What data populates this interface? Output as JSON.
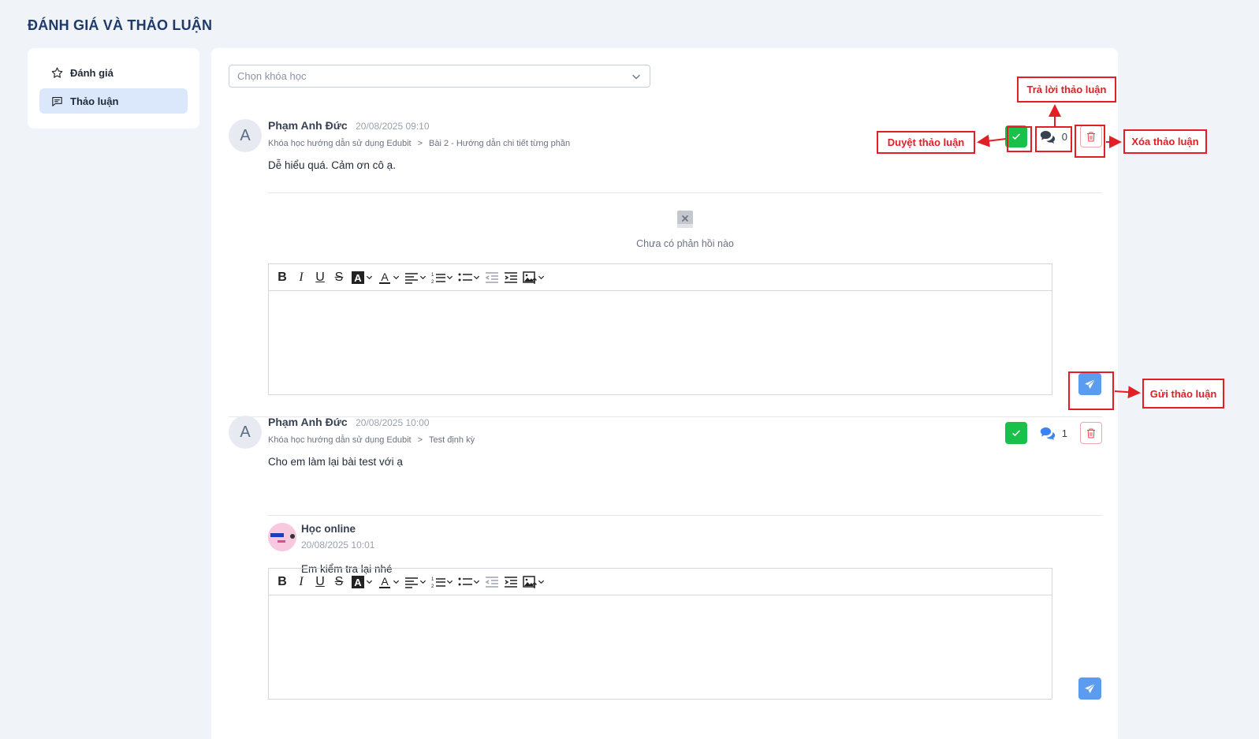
{
  "page": {
    "title": "ĐÁNH GIÁ VÀ THẢO LUẬN"
  },
  "sidebar": {
    "items": [
      {
        "label": "Đánh giá",
        "icon": "star-icon",
        "active": false
      },
      {
        "label": "Thảo luận",
        "icon": "chat-icon",
        "active": true
      }
    ]
  },
  "course_select": {
    "placeholder": "Chọn khóa học"
  },
  "discussions": [
    {
      "avatar_letter": "A",
      "author": "Phạm Anh Đức",
      "time": "20/08/2025 09:10",
      "course": "Khóa học hướng dẫn sử dụng Edubit",
      "separator": ">",
      "lesson": "Bài 2 - Hướng dẫn chi tiết từng phần",
      "content": "Dễ hiểu quá. Cảm ơn cô ạ.",
      "reply_count": "0",
      "empty_text": "Chưa có phản hồi nào"
    },
    {
      "avatar_letter": "A",
      "author": "Phạm Anh Đức",
      "time": "20/08/2025 10:00",
      "course": "Khóa học hướng dẫn sử dụng Edubit",
      "separator": ">",
      "lesson": "Test định kỳ",
      "content": "Cho em làm lại bài test với ạ",
      "reply_count": "1",
      "reply": {
        "author": "Học online",
        "time": "20/08/2025 10:01",
        "text": "Em kiểm tra lại nhé"
      }
    }
  ],
  "annotations": {
    "approve": "Duyệt thảo luận",
    "reply": "Trả lời thảo luận",
    "delete": "Xóa thảo luận",
    "send": "Gửi thảo luận"
  },
  "colors": {
    "approve_green": "#19c04a",
    "send_blue": "#5b9bf0",
    "annotation_red": "#e31e24",
    "active_sidebar": "#dbe8fb",
    "title_navy": "#1e3a6b"
  }
}
